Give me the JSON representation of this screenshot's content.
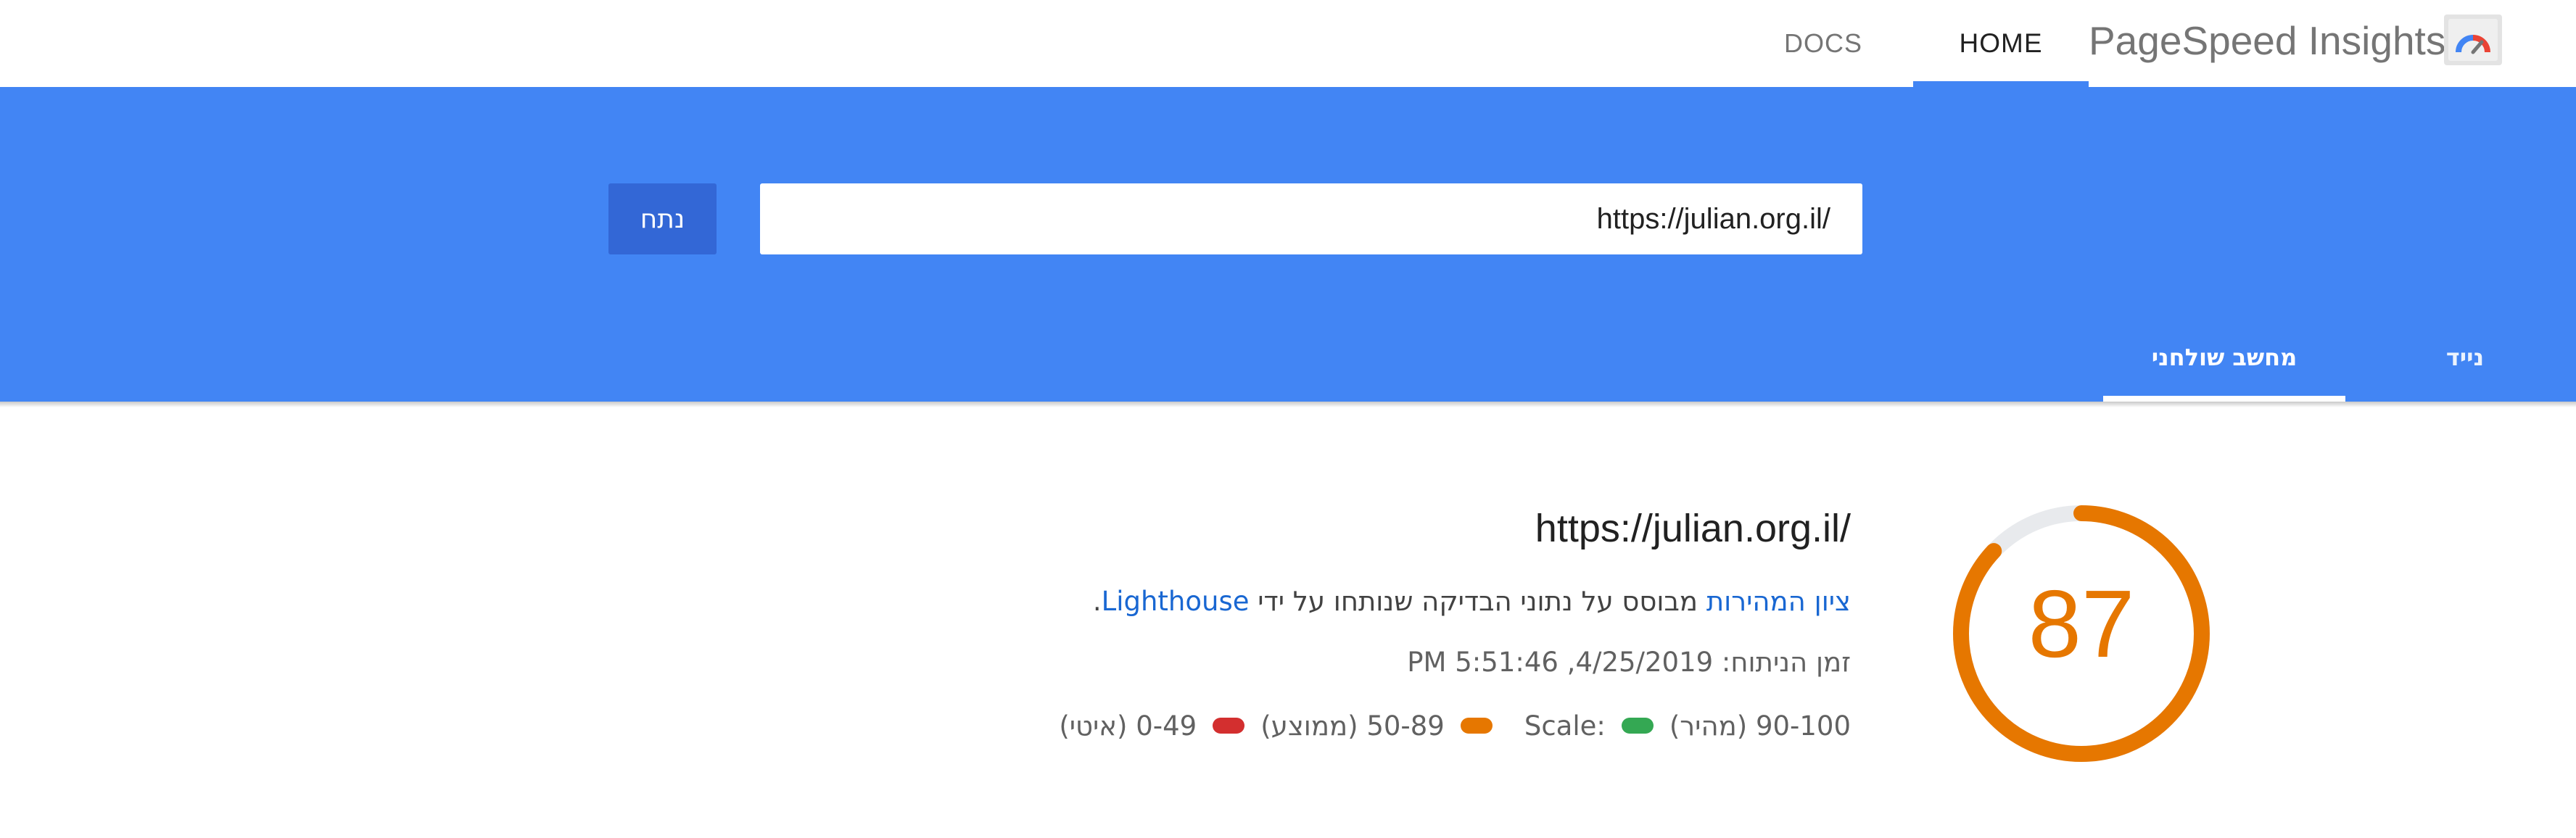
{
  "header": {
    "nav_docs": "DOCS",
    "nav_home": "HOME",
    "brand_title": "PageSpeed Insights",
    "logo_icon": "pagespeed-gauge-icon"
  },
  "search": {
    "url_value": "https://julian.org.il/",
    "analyze_label": "נתח"
  },
  "tabs": {
    "mobile_label": "נייד",
    "desktop_label": "מחשב שולחני",
    "active": "desktop"
  },
  "result": {
    "url": "https://julian.org.il/",
    "score": "87",
    "score_fraction": 0.87,
    "score_link": "ציון המהירות",
    "score_text": " מבוסס על נתוני הבדיקה שנותחו על ידי ",
    "lighthouse_link": "Lighthouse",
    "score_text_end": ".",
    "analysis_time": "זמן הניתוח: 4/25/2019, 5:51:46 PM",
    "legend": {
      "scale_label": "Scale:",
      "fast": "90-100 (מהיר)",
      "average": "50-89 (ממוצע)",
      "slow": "0-49 (איטי)"
    }
  },
  "colors": {
    "brand_blue": "#4285f4",
    "button_blue": "#3367d6",
    "score_orange": "#e67700",
    "fast_green": "#34a853",
    "average_orange": "#e67700",
    "slow_red": "#d32f2f",
    "gauge_track": "#e8eaed"
  }
}
